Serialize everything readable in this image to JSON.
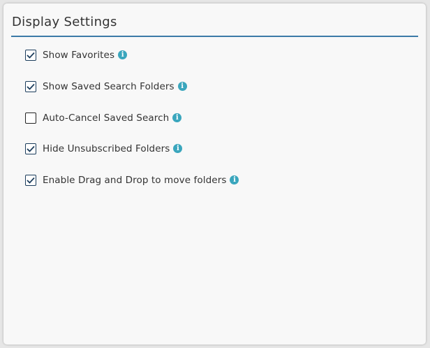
{
  "panel": {
    "title": "Display Settings"
  },
  "options": [
    {
      "label": "Show Favorites",
      "checked": true,
      "info_icon": "i"
    },
    {
      "label": "Show Saved Search Folders",
      "checked": true,
      "info_icon": "i"
    },
    {
      "label": "Auto-Cancel Saved Search",
      "checked": false,
      "info_icon": "i"
    },
    {
      "label": "Hide Unsubscribed Folders",
      "checked": true,
      "info_icon": "i"
    },
    {
      "label": "Enable Drag and Drop to move folders",
      "checked": true,
      "info_icon": "i"
    }
  ],
  "colors": {
    "accent_line": "#3b7aa7",
    "checkbox_border": "#1c3d5c",
    "info_icon": "#3aa6bd"
  }
}
